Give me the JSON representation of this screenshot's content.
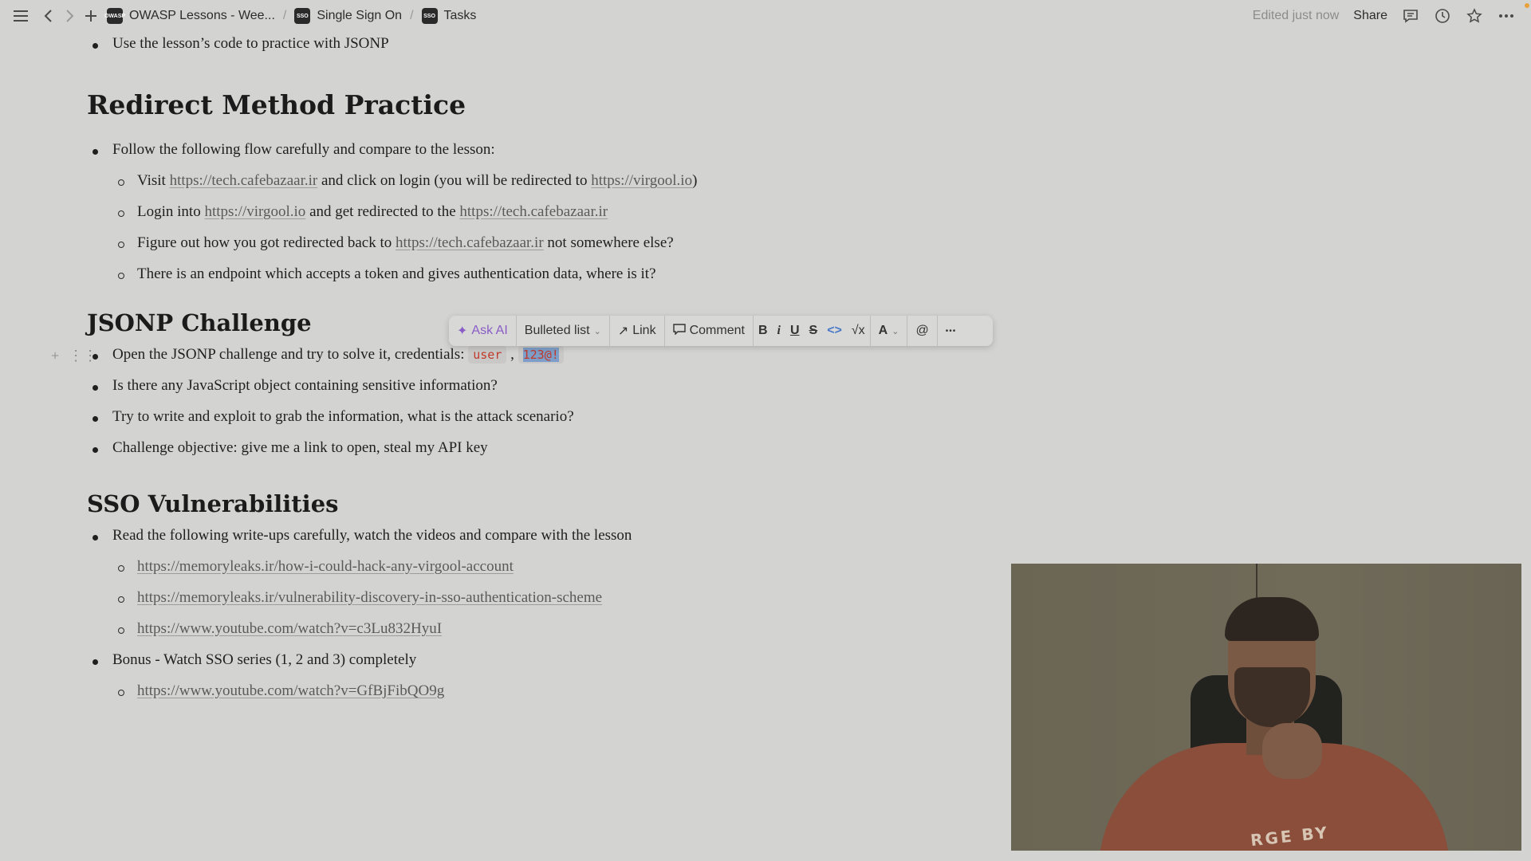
{
  "breadcrumbs": [
    {
      "label": "OWASP Lessons - Wee...",
      "logo": "OWASP"
    },
    {
      "label": "Single Sign On",
      "logo": "SSO"
    },
    {
      "label": "Tasks",
      "logo": "SSO"
    }
  ],
  "breadcrumb_separator": "/",
  "topbar": {
    "edited": "Edited just now",
    "share": "Share"
  },
  "intro_bullet": "Use the lesson’s code to practice with JSONP",
  "redirect": {
    "heading": "Redirect Method Practice",
    "bullet": "Follow the following flow carefully and compare to the lesson:",
    "sub1": {
      "pre": "Visit ",
      "link1": "https://tech.cafebazaar.ir",
      "mid": " and click on login (you will be redirected to ",
      "link2": "https://virgool.io",
      "post": ")"
    },
    "sub2": {
      "pre": "Login into ",
      "link1": "https://virgool.io",
      "mid": " and get redirected to the ",
      "link2": "https://tech.cafebazaar.ir"
    },
    "sub3": {
      "pre": "Figure out how you got redirected back to ",
      "link1": "https://tech.cafebazaar.ir",
      "post": " not somewhere else?"
    },
    "sub4": "There is an endpoint which accepts a token and gives authentication data, where is it?"
  },
  "jsonp": {
    "heading": "JSONP Challenge",
    "b1_text": "Open the JSONP challenge and try to solve it, credentials: ",
    "b1_code1": "user",
    "b1_comma": ",",
    "b1_code2": "123@!",
    "b2": "Is there any JavaScript object containing sensitive information?",
    "b3": "Try to write and exploit to grab the information, what is the attack scenario?",
    "b4": "Challenge objective: give me a link to open, steal my API key"
  },
  "toolbar": {
    "ask_ai": "Ask AI",
    "block_type": "Bulleted list",
    "link": "Link",
    "comment": "Comment",
    "bold": "B",
    "italic": "i",
    "underline": "U",
    "strike": "S",
    "code": "<>",
    "equation": "√x",
    "color": "A",
    "mention": "@",
    "more": "•••"
  },
  "sso": {
    "heading": "SSO Vulnerabilities",
    "b1": "Read the following write-ups carefully, watch the videos and compare with the lesson",
    "links": [
      "https://memoryleaks.ir/how-i-could-hack-any-virgool-account",
      "https://memoryleaks.ir/vulnerability-discovery-in-sso-authentication-scheme",
      "https://www.youtube.com/watch?v=c3Lu832HyuI"
    ],
    "b2": "Bonus - Watch SSO series (1, 2 and 3) completely",
    "bonus_link": "https://www.youtube.com/watch?v=GfBjFibQO9g"
  },
  "webcam": {
    "shirt_text": "RGE BY"
  },
  "colors": {
    "accent_ai": "#8a5cc6",
    "code_text": "#c0392b",
    "selection": "#7d9ec8"
  }
}
